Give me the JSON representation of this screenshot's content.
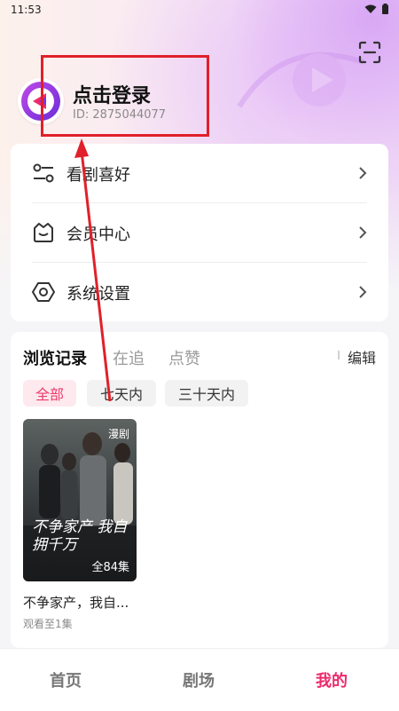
{
  "status_bar": {
    "time": "11:53"
  },
  "header": {
    "login_text": "点击登录",
    "user_id": "ID: 2875044077"
  },
  "menu": {
    "items": [
      {
        "label": "看剧喜好",
        "icon": "sliders-icon"
      },
      {
        "label": "会员中心",
        "icon": "basket-icon"
      },
      {
        "label": "系统设置",
        "icon": "hexagon-settings-icon"
      }
    ]
  },
  "history": {
    "tabs": [
      "浏览记录",
      "在追",
      "点赞"
    ],
    "active_tab": "浏览记录",
    "edit_label": "编辑",
    "filters": [
      "全部",
      "七天内",
      "三十天内"
    ],
    "active_filter": "全部",
    "items": [
      {
        "tag": "漫剧",
        "episode_count": "全84集",
        "poster_text": "不争家产 我自拥千万",
        "title": "不争家产，我自...",
        "progress": "观看至1集"
      }
    ]
  },
  "bottom_nav": {
    "items": [
      "首页",
      "剧场",
      "我的"
    ],
    "active": "我的"
  },
  "colors": {
    "accent": "#ee2a6b",
    "annotation_red": "#e0202a",
    "avatar_purple": "#9b3fe0"
  }
}
